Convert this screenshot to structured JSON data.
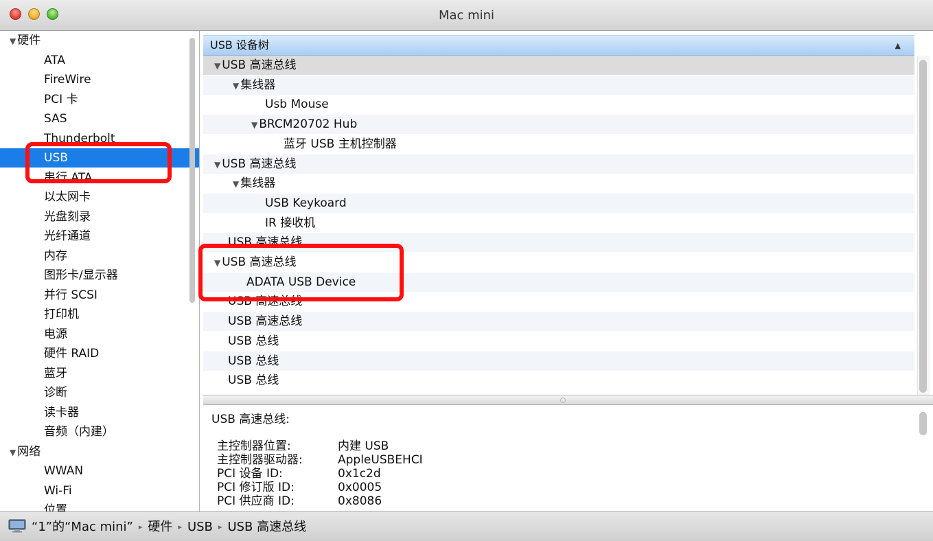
{
  "window": {
    "title": "Mac mini"
  },
  "sidebar": {
    "items": [
      {
        "label": "硬件",
        "level": 0,
        "expanded": true
      },
      {
        "label": "ATA",
        "level": 1
      },
      {
        "label": "FireWire",
        "level": 1
      },
      {
        "label": "PCI 卡",
        "level": 1
      },
      {
        "label": "SAS",
        "level": 1
      },
      {
        "label": "Thunderbolt",
        "level": 1
      },
      {
        "label": "USB",
        "level": 1,
        "selected": true
      },
      {
        "label": "串行 ATA",
        "level": 1
      },
      {
        "label": "以太网卡",
        "level": 1
      },
      {
        "label": "光盘刻录",
        "level": 1
      },
      {
        "label": "光纤通道",
        "level": 1
      },
      {
        "label": "内存",
        "level": 1
      },
      {
        "label": "图形卡/显示器",
        "level": 1
      },
      {
        "label": "并行 SCSI",
        "level": 1
      },
      {
        "label": "打印机",
        "level": 1
      },
      {
        "label": "电源",
        "level": 1
      },
      {
        "label": "硬件 RAID",
        "level": 1
      },
      {
        "label": "蓝牙",
        "level": 1
      },
      {
        "label": "诊断",
        "level": 1
      },
      {
        "label": "读卡器",
        "level": 1
      },
      {
        "label": "音频（内建）",
        "level": 1
      },
      {
        "label": "网络",
        "level": 0,
        "expanded": true
      },
      {
        "label": "WWAN",
        "level": 1
      },
      {
        "label": "Wi-Fi",
        "level": 1
      },
      {
        "label": "位置",
        "level": 1
      }
    ]
  },
  "tree": {
    "header": "USB 设备树",
    "rows": [
      {
        "label": "USB 高速总线",
        "indent": 0,
        "expanded": true,
        "selected": true
      },
      {
        "label": "集线器",
        "indent": 1,
        "expanded": true
      },
      {
        "label": "Usb Mouse",
        "indent": 2
      },
      {
        "label": "BRCM20702 Hub",
        "indent": 2,
        "expanded": true
      },
      {
        "label": "蓝牙 USB 主机控制器",
        "indent": 3
      },
      {
        "label": "USB 高速总线",
        "indent": 0,
        "expanded": true
      },
      {
        "label": "集线器",
        "indent": 1,
        "expanded": true
      },
      {
        "label": "USB Keykoard",
        "indent": 2
      },
      {
        "label": "IR 接收机",
        "indent": 2
      },
      {
        "label": "USB 高速总线",
        "indent": 0
      },
      {
        "label": "USB 高速总线",
        "indent": 0,
        "expanded": true
      },
      {
        "label": "ADATA USB Device",
        "indent": 1
      },
      {
        "label": "USB 高速总线",
        "indent": 0
      },
      {
        "label": "USB 高速总线",
        "indent": 0
      },
      {
        "label": "USB 总线",
        "indent": 0
      },
      {
        "label": "USB 总线",
        "indent": 0
      },
      {
        "label": "USB 总线",
        "indent": 0
      }
    ]
  },
  "detail": {
    "title": "USB 高速总线:",
    "fields": [
      {
        "key": "主控制器位置:",
        "value": "内建 USB"
      },
      {
        "key": "主控制器驱动器:",
        "value": "AppleUSBEHCI"
      },
      {
        "key": "PCI 设备 ID:",
        "value": "0x1c2d"
      },
      {
        "key": "PCI 修订版 ID:",
        "value": "0x0005"
      },
      {
        "key": "PCI 供应商 ID:",
        "value": "0x8086"
      }
    ]
  },
  "statusbar": {
    "path": [
      "“1”的“Mac mini”",
      "硬件",
      "USB",
      "USB 高速总线"
    ],
    "separator": "▸"
  },
  "colors": {
    "selection": "#1a7de8",
    "highlight_box": "#ff1010"
  }
}
